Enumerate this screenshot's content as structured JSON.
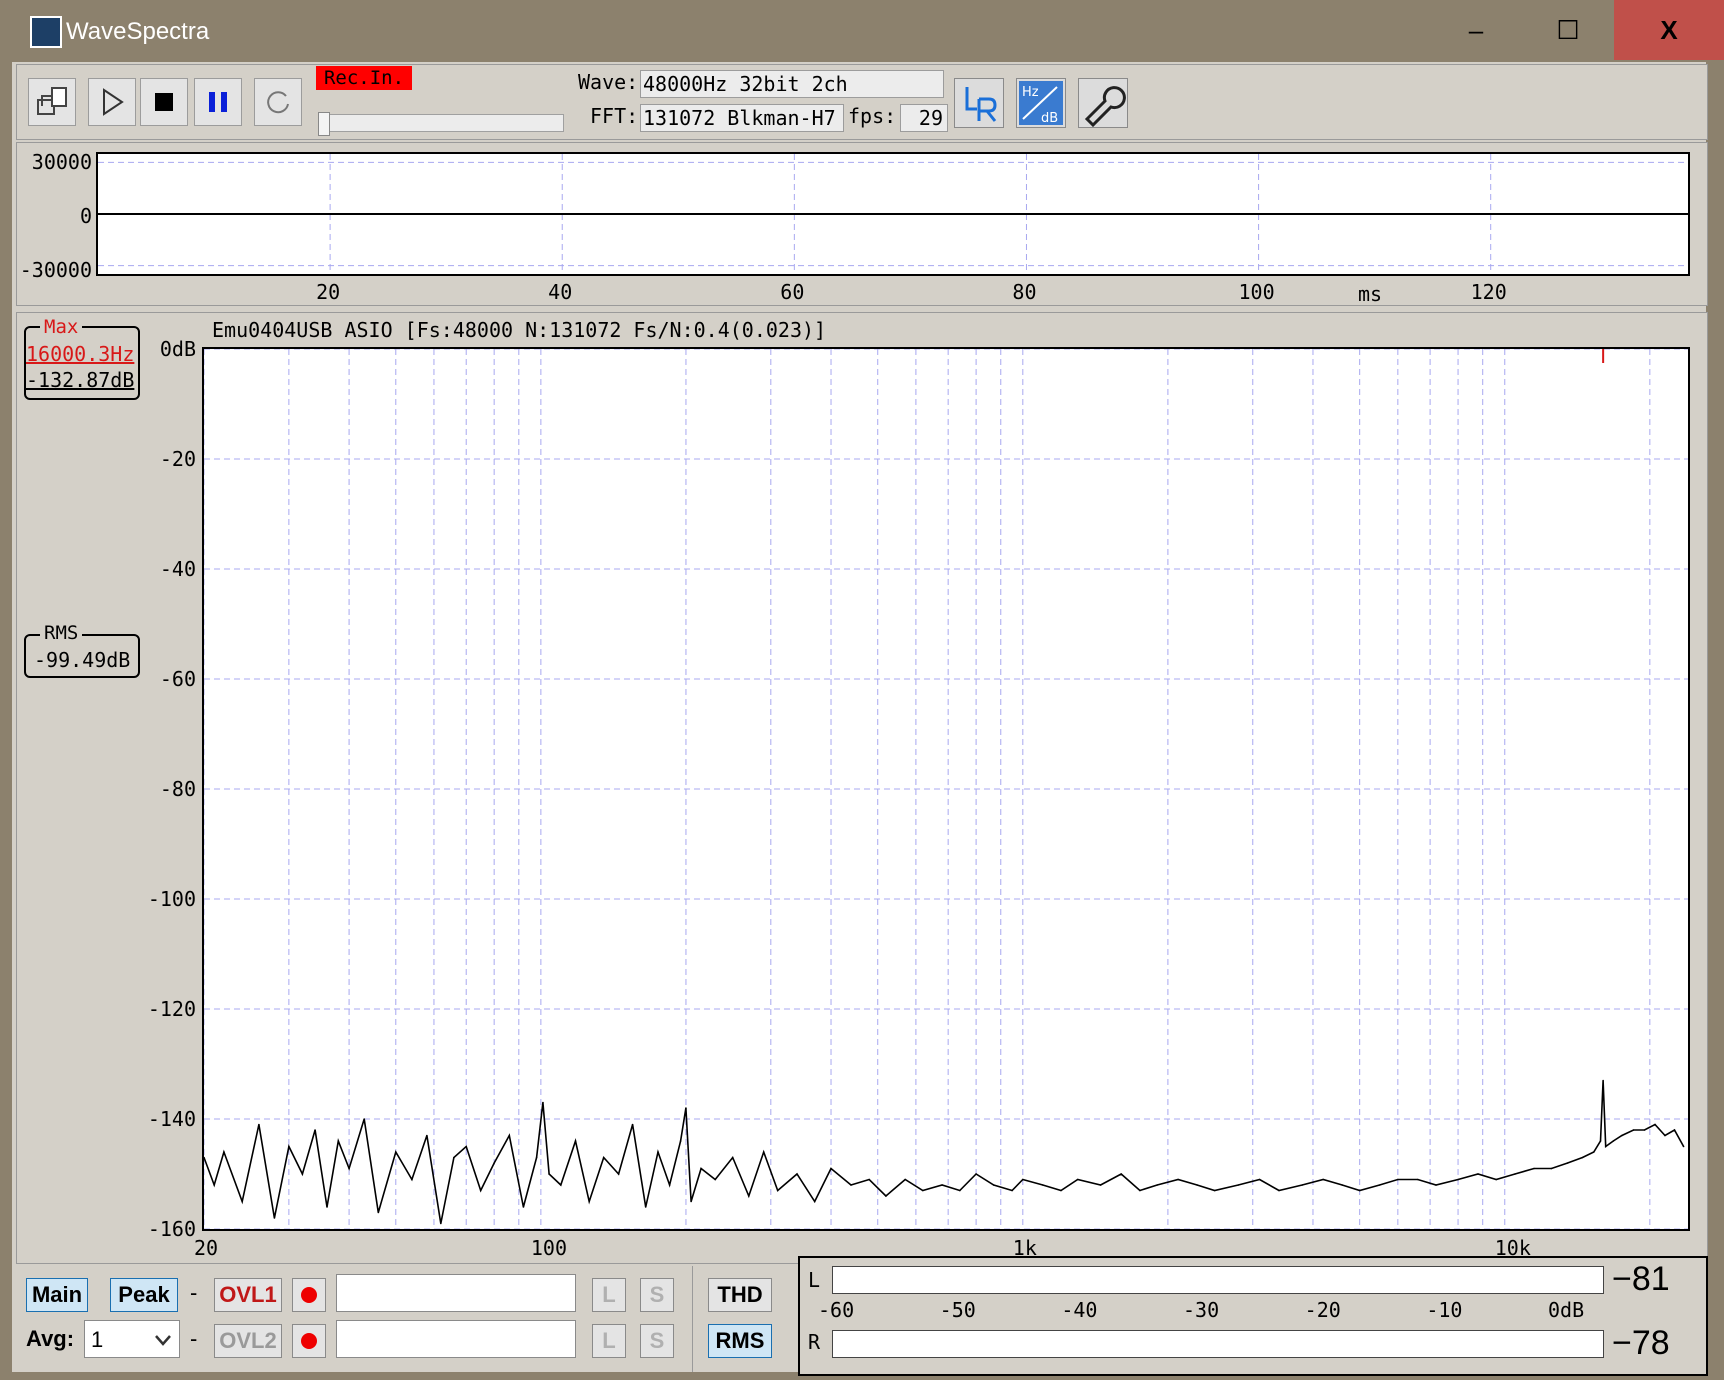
{
  "window": {
    "title": "WaveSpectra",
    "minimize": "‒",
    "maximize": "☐",
    "close": "X"
  },
  "toolbar": {
    "rec_label": "Rec.In.",
    "wave_label": "Wave:",
    "wave_value": "48000Hz 32bit 2ch",
    "fft_label": "FFT:",
    "fft_value": "131072 Blkman-H7",
    "fps_label": "fps:",
    "fps_value": "29",
    "buttons": [
      "export-icon",
      "play-icon",
      "stop-icon",
      "pause-icon",
      "refresh-icon",
      "lr-icon",
      "hz-db-icon",
      "settings-wrench-icon"
    ]
  },
  "wave": {
    "y_labels": [
      "30000",
      "0",
      "-30000"
    ],
    "x_labels": [
      "20",
      "40",
      "60",
      "80",
      "100",
      "120"
    ],
    "x_unit": "ms",
    "x_max": 137
  },
  "spectrum": {
    "title": "Emu0404USB ASIO  [Fs:48000 N:131072 Fs/N:0.4(0.023)]",
    "max_label": "Max",
    "max_freq": "16000.3Hz",
    "max_db": "-132.87dB",
    "rms_label": "RMS",
    "rms_db": "-99.49dB",
    "y_labels": [
      "0dB",
      "-20",
      "-40",
      "-60",
      "-80",
      "-100",
      "-120",
      "-140",
      "-160"
    ],
    "x_labels": [
      "20",
      "100",
      "1k",
      "10k"
    ]
  },
  "chart_data": {
    "type": "line",
    "x_scale": "log",
    "xlim": [
      20,
      24000
    ],
    "ylim": [
      -160,
      0
    ],
    "xlabel": "",
    "ylabel": "",
    "grid": true,
    "x": [
      20,
      21,
      22,
      24,
      26,
      28,
      30,
      32,
      34,
      36,
      38,
      40,
      43,
      46,
      50,
      54,
      58,
      62,
      66,
      70,
      75,
      80,
      86,
      92,
      98,
      101,
      104,
      110,
      118,
      126,
      135,
      145,
      155,
      165,
      175,
      185,
      195,
      200,
      205,
      215,
      230,
      250,
      270,
      290,
      310,
      340,
      370,
      400,
      440,
      480,
      520,
      570,
      620,
      680,
      740,
      800,
      870,
      950,
      1000,
      1100,
      1200,
      1300,
      1450,
      1600,
      1750,
      1900,
      2100,
      2300,
      2500,
      2800,
      3100,
      3400,
      3800,
      4200,
      4600,
      5000,
      5500,
      6000,
      6600,
      7200,
      8000,
      8800,
      9600,
      10500,
      11500,
      12500,
      13500,
      14500,
      15300,
      15800,
      16000,
      16200,
      16800,
      17500,
      18500,
      19500,
      20500,
      21500,
      22500,
      23500
    ],
    "values": [
      -147,
      -152,
      -146,
      -155,
      -141,
      -158,
      -145,
      -150,
      -142,
      -156,
      -144,
      -149,
      -140,
      -157,
      -146,
      -151,
      -143,
      -159,
      -147,
      -145,
      -153,
      -148,
      -143,
      -156,
      -147,
      -137,
      -150,
      -152,
      -144,
      -155,
      -147,
      -150,
      -141,
      -156,
      -146,
      -152,
      -144,
      -138,
      -155,
      -149,
      -151,
      -147,
      -154,
      -146,
      -153,
      -150,
      -155,
      -149,
      -152,
      -151,
      -154,
      -151,
      -153,
      -152,
      -153,
      -150,
      -152,
      -153,
      -151,
      -152,
      -153,
      -151,
      -152,
      -150,
      -153,
      -152,
      -151,
      -152,
      -153,
      -152,
      -151,
      -153,
      -152,
      -151,
      -152,
      -153,
      -152,
      -151,
      -151,
      -152,
      -151,
      -150,
      -151,
      -150,
      -149,
      -149,
      -148,
      -147,
      -146,
      -144,
      -133,
      -145,
      -144,
      -143,
      -142,
      -142,
      -141,
      -143,
      -142,
      -145
    ]
  },
  "bottom": {
    "main": "Main",
    "peak": "Peak",
    "dash1": "-",
    "dash2": "-",
    "ovl1": "OVL1",
    "ovl2": "OVL2",
    "l": "L",
    "s": "S",
    "avg_label": "Avg:",
    "avg_value": "1",
    "thd": "THD",
    "rms": "RMS"
  },
  "meter": {
    "l_label": "L",
    "r_label": "R",
    "l_value": "−81",
    "r_value": "−78",
    "scale": [
      "-60",
      "-50",
      "-40",
      "-30",
      "-20",
      "-10",
      "0dB"
    ]
  }
}
